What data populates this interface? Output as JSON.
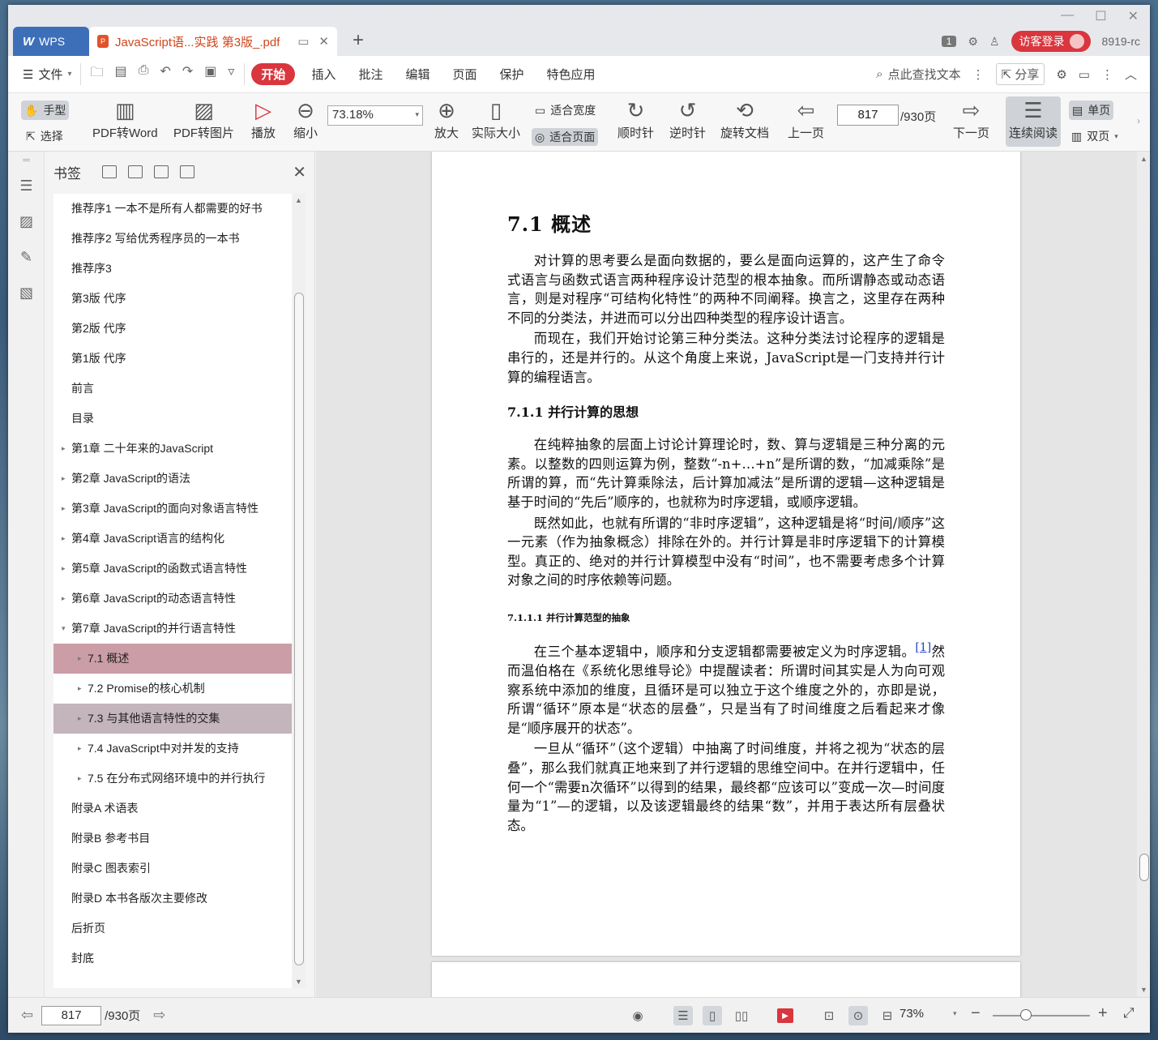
{
  "tabbar": {
    "app_tab": "WPS",
    "doc_tab": "JavaScript语...实践 第3版_.pdf",
    "badge": "1",
    "login": "访客登录",
    "user_code": "8919-rc"
  },
  "menubar": {
    "file": "文件",
    "items": [
      "开始",
      "插入",
      "批注",
      "编辑",
      "页面",
      "保护",
      "特色应用"
    ],
    "search": "点此查找文本",
    "share": "分享"
  },
  "ribbon": {
    "hand": "手型",
    "select": "选择",
    "pdf_to_word": "PDF转Word",
    "pdf_to_image": "PDF转图片",
    "play": "播放",
    "zoom_out": "缩小",
    "zoom_value": "73.18%",
    "zoom_in": "放大",
    "actual_size": "实际大小",
    "fit_width": "适合宽度",
    "fit_page": "适合页面",
    "clockwise": "顺时针",
    "counter_clockwise": "逆时针",
    "rotate_doc": "旋转文档",
    "prev_page": "上一页",
    "page_current": "817",
    "page_total": "/930页",
    "next_page": "下一页",
    "continuous": "连续阅读",
    "single_page": "单页",
    "double_page": "双页"
  },
  "bookmarks": {
    "title": "书签",
    "items": [
      {
        "label": "推荐序1 一本不是所有人都需要的好书",
        "level": 0,
        "arrow": ""
      },
      {
        "label": "推荐序2 写给优秀程序员的一本书",
        "level": 0,
        "arrow": ""
      },
      {
        "label": "推荐序3",
        "level": 0,
        "arrow": ""
      },
      {
        "label": "第3版 代序",
        "level": 0,
        "arrow": ""
      },
      {
        "label": "第2版 代序",
        "level": 0,
        "arrow": ""
      },
      {
        "label": "第1版 代序",
        "level": 0,
        "arrow": ""
      },
      {
        "label": "前言",
        "level": 0,
        "arrow": ""
      },
      {
        "label": "目录",
        "level": 0,
        "arrow": ""
      },
      {
        "label": "第1章 二十年来的JavaScript",
        "level": 0,
        "arrow": "▸"
      },
      {
        "label": "第2章 JavaScript的语法",
        "level": 0,
        "arrow": "▸"
      },
      {
        "label": "第3章 JavaScript的面向对象语言特性",
        "level": 0,
        "arrow": "▸"
      },
      {
        "label": "第4章 JavaScript语言的结构化",
        "level": 0,
        "arrow": "▸"
      },
      {
        "label": "第5章 JavaScript的函数式语言特性",
        "level": 0,
        "arrow": "▸"
      },
      {
        "label": "第6章 JavaScript的动态语言特性",
        "level": 0,
        "arrow": "▸"
      },
      {
        "label": "第7章 JavaScript的并行语言特性",
        "level": 0,
        "arrow": "▾"
      },
      {
        "label": "7.1 概述",
        "level": 1,
        "arrow": "▸",
        "highlight": "hl1"
      },
      {
        "label": "7.2 Promise的核心机制",
        "level": 1,
        "arrow": "▸"
      },
      {
        "label": "7.3 与其他语言特性的交集",
        "level": 1,
        "arrow": "▸",
        "highlight": "hl2"
      },
      {
        "label": "7.4 JavaScript中对并发的支持",
        "level": 1,
        "arrow": "▸"
      },
      {
        "label": "7.5 在分布式网络环境中的并行执行",
        "level": 1,
        "arrow": "▸"
      },
      {
        "label": "附录A 术语表",
        "level": 0,
        "arrow": ""
      },
      {
        "label": "附录B 参考书目",
        "level": 0,
        "arrow": ""
      },
      {
        "label": "附录C 图表索引",
        "level": 0,
        "arrow": ""
      },
      {
        "label": "附录D 本书各版次主要修改",
        "level": 0,
        "arrow": ""
      },
      {
        "label": "后折页",
        "level": 0,
        "arrow": ""
      },
      {
        "label": "封底",
        "level": 0,
        "arrow": ""
      }
    ]
  },
  "document": {
    "h1": "7.1 概述",
    "p1": "对计算的思考要么是面向数据的，要么是面向运算的，这产生了命令式语言与函数式语言两种程序设计范型的根本抽象。而所谓静态或动态语言，则是对程序“可结构化特性”的两种不同阐释。换言之，这里存在两种不同的分类法，并进而可以分出四种类型的程序设计语言。",
    "p2": "而现在，我们开始讨论第三种分类法。这种分类法讨论程序的逻辑是串行的，还是并行的。从这个角度上来说，JavaScript是一门支持并行计算的编程语言。",
    "h2": "7.1.1 并行计算的思想",
    "p3": "在纯粹抽象的层面上讨论计算理论时，数、算与逻辑是三种分离的元素。以整数的四则运算为例，整数“-n+…+n”是所谓的数，“加减乘除”是所谓的算，而“先计算乘除法，后计算加减法”是所谓的逻辑—这种逻辑是基于时间的“先后”顺序的，也就称为时序逻辑，或顺序逻辑。",
    "p4": "既然如此，也就有所谓的“非时序逻辑”，这种逻辑是将“时间/顺序”这一元素（作为抽象概念）排除在外的。并行计算是非时序逻辑下的计算模型。真正的、绝对的并行计算模型中没有“时间”，也不需要考虑多个计算对象之间的时序依赖等问题。",
    "h3": "7.1.1.1 并行计算范型的抽象",
    "p5a": "在三个基本逻辑中，顺序和分支逻辑都需要被定义为时序逻辑。",
    "fn": "[1]",
    "p5b": "然而温伯格在《系统化思维导论》中提醒读者：所谓时间其实是人为向可观察系统中添加的维度，且循环是可以独立于这个维度之外的，亦即是说，所谓“循环”原本是“状态的层叠”，只是当有了时间维度之后看起来才像是“顺序展开的状态”。",
    "p6": "一旦从“循环”（这个逻辑）中抽离了时间维度，并将之视为“状态的层叠”，那么我们就真正地来到了并行逻辑的思维空间中。在并行逻辑中，任何一个“需要n次循环”以得到的结果，最终都“应该可以”变成一次—时间度量为“1”—的逻辑，以及该逻辑最终的结果“数”，并用于表达所有层叠状态。"
  },
  "statusbar": {
    "page_current": "817",
    "page_total": "/930页",
    "zoom": "73%"
  }
}
